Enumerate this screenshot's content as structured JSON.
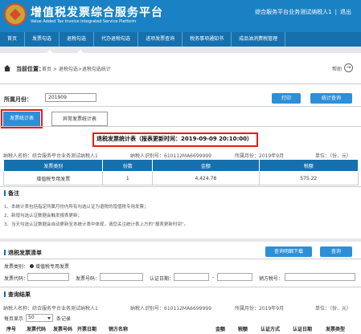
{
  "header": {
    "title": "增值税发票综合服务平台",
    "subtitle": "Value Added Tax Invoice Integrated Service Platform",
    "user": "综合服务平台业务测试纳税人1",
    "logout": "退出"
  },
  "nav": [
    {
      "label": "首页",
      "active": false
    },
    {
      "label": "发票勾选",
      "active": true
    },
    {
      "label": "退税勾选",
      "active": true
    },
    {
      "label": "代办退税勾选",
      "active": false
    },
    {
      "label": "进项发票查询",
      "active": false
    },
    {
      "label": "税务事项通知书",
      "active": false
    },
    {
      "label": "成品油消费税管理",
      "active": false
    }
  ],
  "breadcrumb": {
    "label": "当前位置：",
    "path": "首页 > 退税勾选>退税勾选统计",
    "help": "帮助",
    "help_icon": "→"
  },
  "form": {
    "month_label": "所属月份：",
    "month_value": "201909",
    "print_button": "打印",
    "stat_query_button": "统计查询"
  },
  "tabs": [
    {
      "label": "发票统计表",
      "active": true
    },
    {
      "label": "异常发票统计表",
      "active": false
    }
  ],
  "stat": {
    "title": "退税发票统计表（报表更新时间：2019-09-09 20:10:00）",
    "taxpayer_name": "纳税人名称：综合服务平台业务测试纳税人1",
    "taxpayer_id": "纳税人识别号：610112MA6699999",
    "period": "所属月份：2019年9月",
    "unit": "单位：（份、元）"
  },
  "table": {
    "headers": [
      "发票类别",
      "份数",
      "金额",
      "税额"
    ],
    "rows": [
      [
        "增值税专用发票",
        "1",
        "4,424.78",
        "575.22"
      ]
    ]
  },
  "notes": {
    "title": "备注",
    "items": [
      "1、本统计表包括指定所属月份内所有勾选认证为退税的增值税专用发票；",
      "2、新增勾选认证数据会触发报表更新；",
      "3、当天勾选认证数据会自动更新至本统计表中体现，请您关注统计表上方的“报表更新时间”。"
    ]
  },
  "list": {
    "title": "退税发票清单",
    "download_button": "查询明细下载",
    "query_button": "查询",
    "invoice_type_label": "发票类别：",
    "invoice_type_value": "增值税专用发票",
    "invoice_code_label": "发票代码：",
    "invoice_number_label": "发票号码：",
    "auth_date_label": "认证日期：",
    "date_sep": "-",
    "seller_tax_label": "销方税号："
  },
  "results": {
    "title": "查询结果",
    "taxpayer_name": "纳税人名称：综合服务平台业务测试纳税人1",
    "taxpayer_id": "纳税人识别号：610112MA6699999",
    "period": "所属月份：2019年9月",
    "unit": "单位：（份、元）",
    "page_size_label": "每页显示",
    "page_size_value": "50",
    "page_size_suffix": "条记录",
    "columns": [
      "序号",
      "发票代码",
      "发票号码",
      "开票日期",
      "销方名称",
      "金额",
      "税额",
      "认证方式",
      "认证日期",
      "发票类型"
    ]
  }
}
